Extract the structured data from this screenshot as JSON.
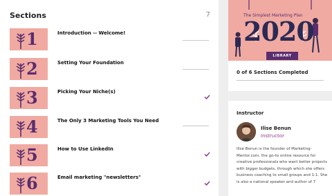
{
  "sections": {
    "title": "Sections",
    "count": "7",
    "items": [
      {
        "number": "1",
        "title": "Introduction -- Welcome!",
        "completed": false
      },
      {
        "number": "2",
        "title": "Setting Your Foundation",
        "completed": false
      },
      {
        "number": "3",
        "title": "Picking Your Niche(s)",
        "completed": true
      },
      {
        "number": "4",
        "title": "The Only 3 Marketing Tools You Need",
        "completed": false
      },
      {
        "number": "5",
        "title": "How to Use LinkedIn",
        "completed": true
      },
      {
        "number": "6",
        "title": "Email marketing \"newsletters\"",
        "completed": true
      }
    ]
  },
  "course": {
    "banner_caption": "The Simplest Marketing Plan",
    "banner_year": "2020",
    "banner_badge": "LIBRARY",
    "completion_text": "0 of 6 Sections Completed"
  },
  "instructor": {
    "heading": "Instructor",
    "name": "Ilise Benun",
    "role": "Instructor",
    "bio": "Ilise Benun is the founder of Marketing-Mentor.com, the go-to online resource for creative professionals who want better projects with bigger budgets, through which she offers business coaching to small groups and 1:1. She is also a national speaker and author of 7"
  },
  "colors": {
    "thumb_bg": "#f0aaa1",
    "accent_purple": "#5a2d6e",
    "check_purple": "#8a3c8c"
  }
}
